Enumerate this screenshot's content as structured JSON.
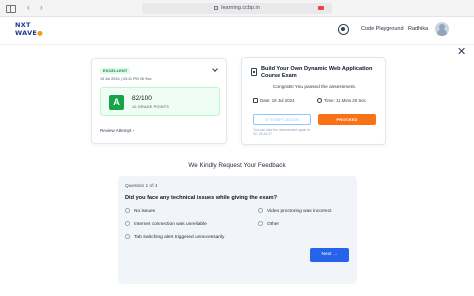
{
  "browser": {
    "url": "learning.ccbp.in"
  },
  "header": {
    "logo_line1": "NXT",
    "logo_line2": "WAVE",
    "playground_label": "Code Playground",
    "username": "Radhika"
  },
  "score_card": {
    "badge": "EXCELLENT",
    "attempt_date": "19 Jul 2024 | 03:11 PM 26 Sec",
    "grade": "A",
    "score": "82/100",
    "points": "10 GRADE POINTS",
    "review_label": "Review Attempt"
  },
  "assessment": {
    "title": "Build Your Own Dynamic Web Application Course Exam",
    "congrats": "Congrats! You passed the assessment.",
    "date": "Date: 19 Jul 2024",
    "time": "Time: 11 Mins 20 Sec",
    "attempt_again_label": "ATTEMPT AGAIN",
    "proceed_label": "PROCEED",
    "retake_note": "You can take the assessment again in 00: 23:44:27"
  },
  "feedback": {
    "heading": "We Kindly Request Your Feedback",
    "question_count": "Question 1 of 4",
    "question": "Did you face any technical issues while giving the exam?",
    "options": [
      "No issues",
      "Video proctoring was incorrect",
      "Internet connection was unreliable",
      "Other",
      "Tab switching alert triggered unnecessarily"
    ],
    "next_label": "Next"
  },
  "colors": {
    "accent": "#2563eb",
    "proceed": "#f97316",
    "grade": "#16a34a"
  }
}
